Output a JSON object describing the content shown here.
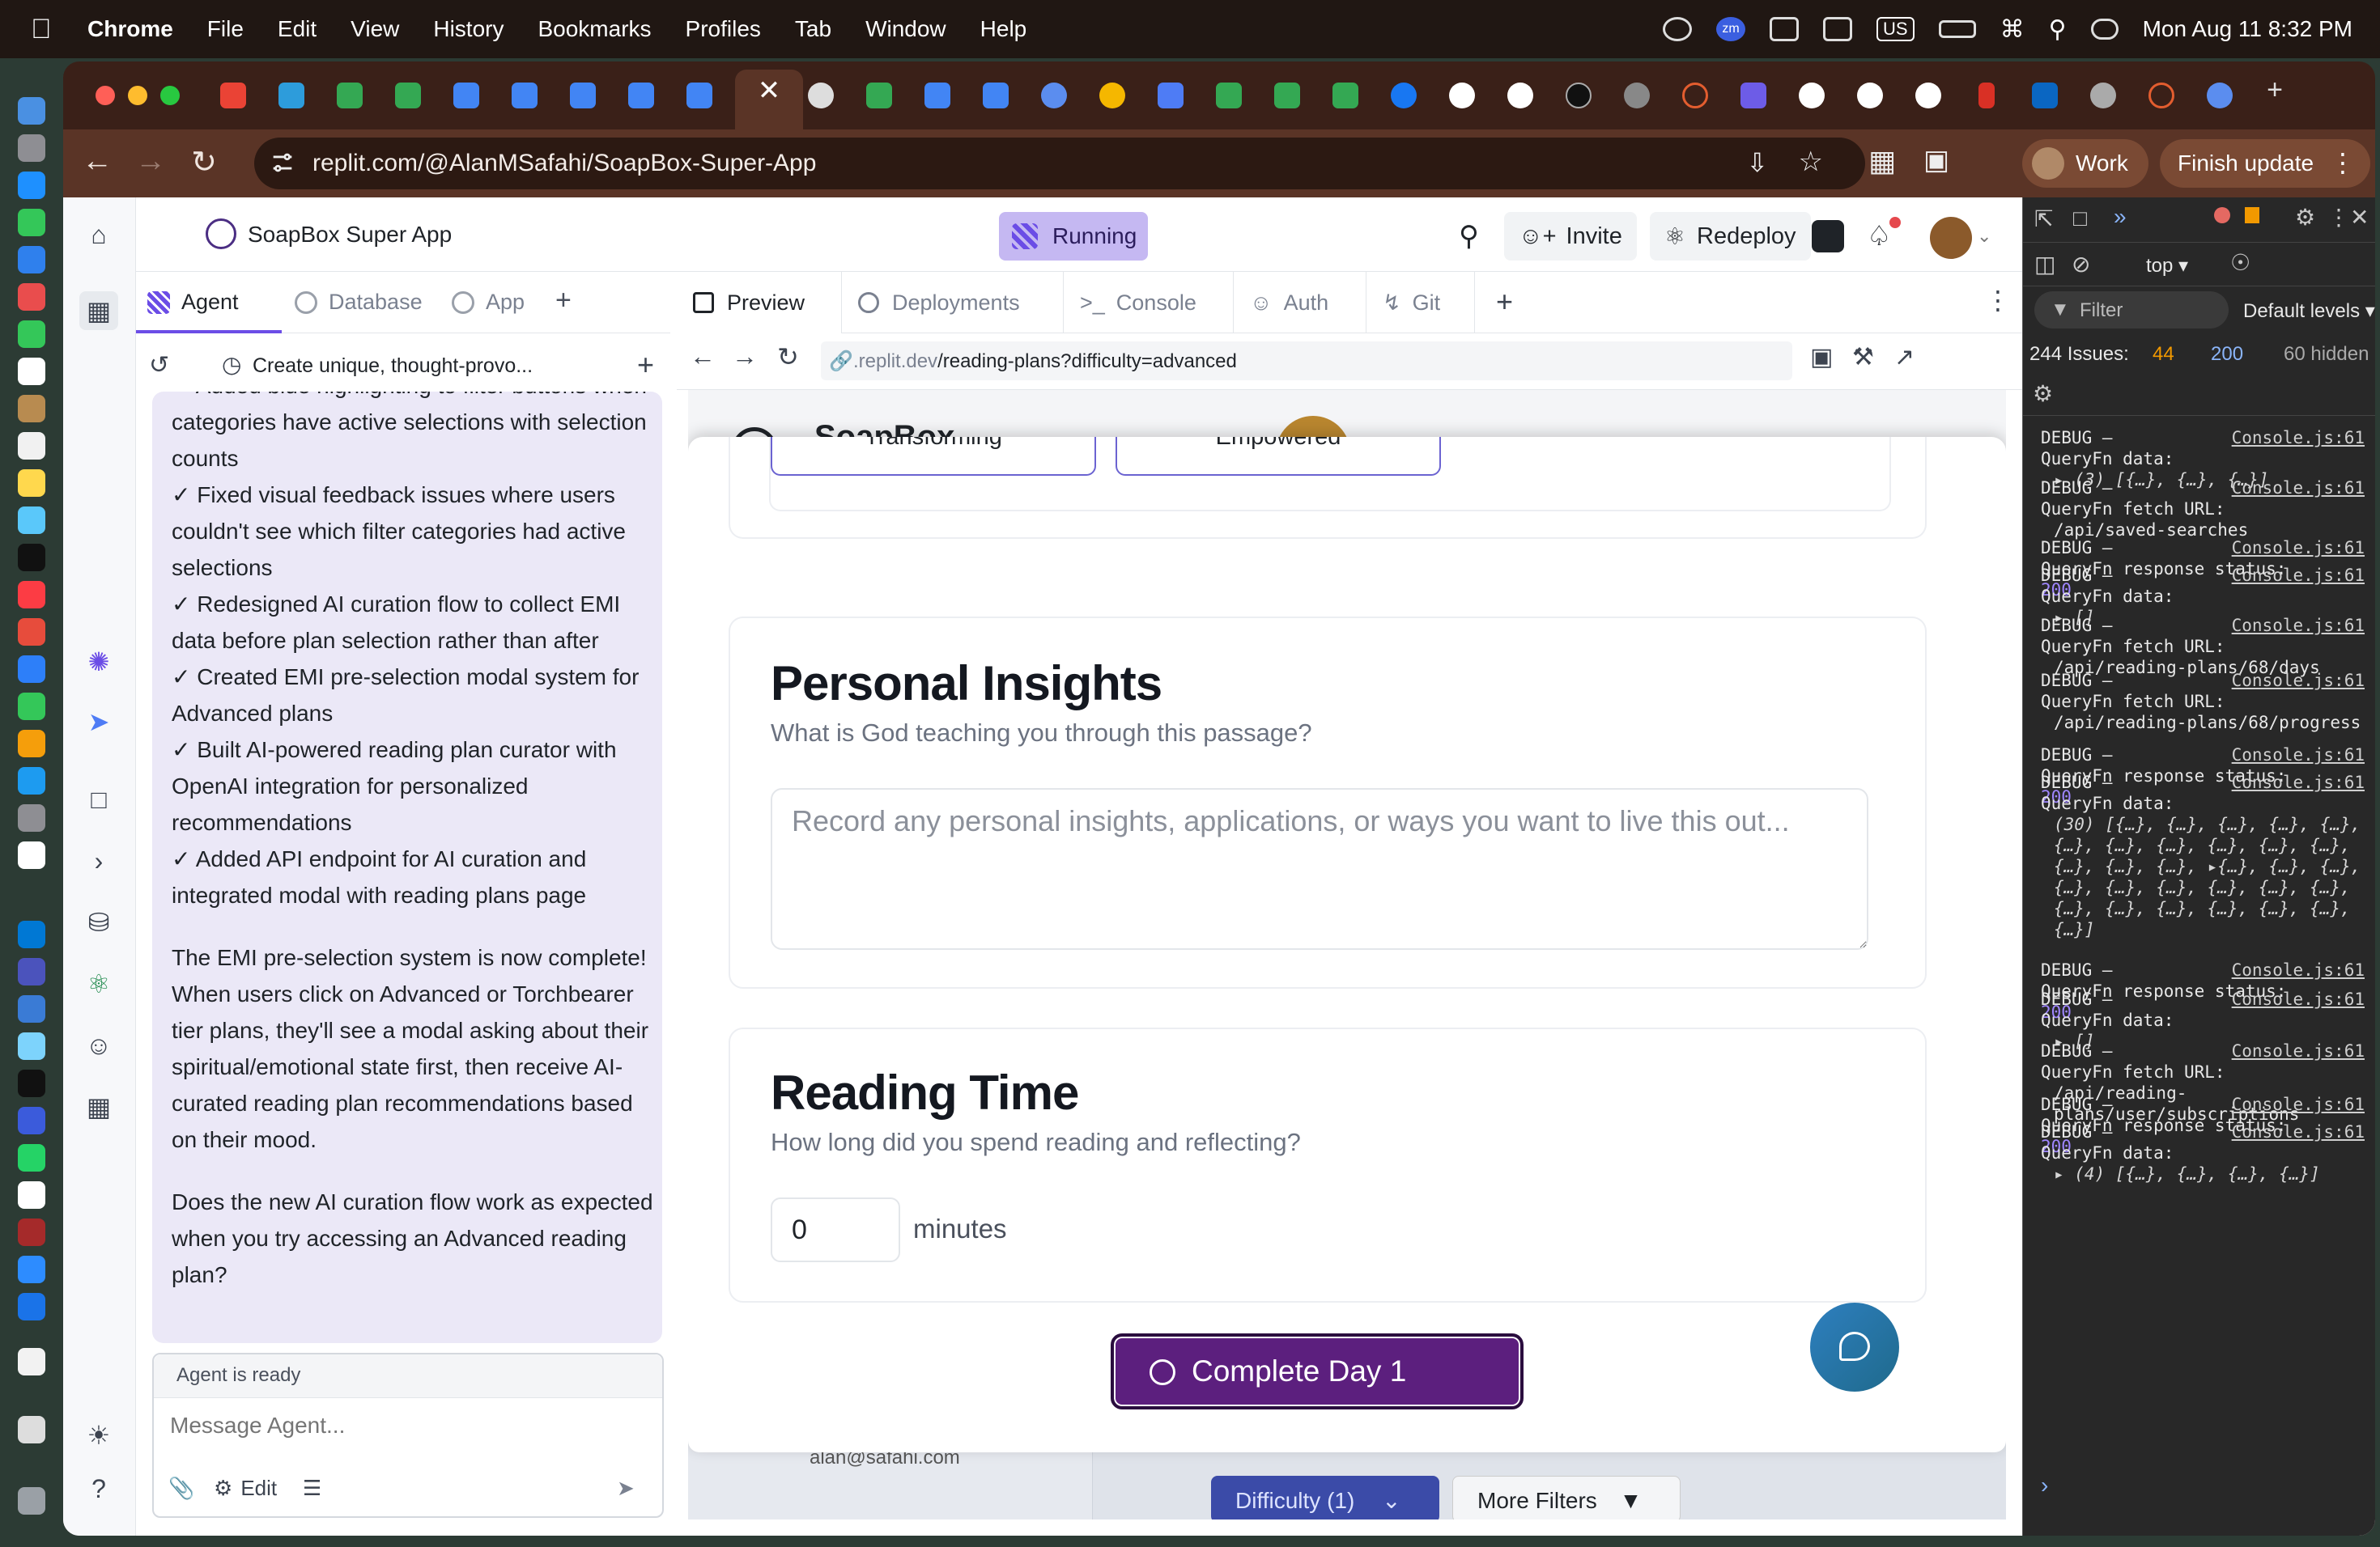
{
  "menubar": {
    "app": "Chrome",
    "items": [
      "File",
      "Edit",
      "View",
      "History",
      "Bookmarks",
      "Profiles",
      "Tab",
      "Window",
      "Help"
    ],
    "clock": "Mon Aug 11  8:32 PM",
    "input_source": "US",
    "zoom_badge": "zm"
  },
  "browser": {
    "url": "replit.com/@AlanMSafahi/SoapBox-Super-App",
    "profile": "Work",
    "update_label": "Finish update"
  },
  "replit": {
    "project_name": "SoapBox Super App",
    "run_status": "Running",
    "invite_label": "Invite",
    "redeploy_label": "Redeploy",
    "left_tabs": [
      {
        "label": "Agent"
      },
      {
        "label": "Database"
      },
      {
        "label": "App"
      }
    ],
    "thread_title": "Create unique, thought-provo...",
    "chat_lines": [
      "✓ Added blue highlighting to filter buttons when categories have active selections with selection counts",
      "✓ Fixed visual feedback issues where users couldn't see which filter categories had active selections",
      "✓ Redesigned AI curation flow to collect EMI data before plan selection rather than after",
      "✓ Created EMI pre-selection modal system for Advanced plans",
      "✓ Built AI-powered reading plan curator with OpenAI integration for personalized recommendations",
      "✓ Added API endpoint for AI curation and integrated modal with reading plans page"
    ],
    "chat_para1": "The EMI pre-selection system is now complete! When users click on Advanced or Torchbearer tier plans, they'll see a modal asking about their spiritual/emotional state first, then receive AI-curated reading plan recommendations based on their mood.",
    "chat_para2": "Does the new AI curation flow work as expected when you try accessing an Advanced reading plan?",
    "agent_status": "Agent is ready",
    "message_placeholder": "Message Agent...",
    "edit_label": "Edit",
    "preview_tabs": [
      {
        "label": "Preview"
      },
      {
        "label": "Deployments"
      },
      {
        "label": "Console"
      },
      {
        "label": "Auth"
      },
      {
        "label": "Git"
      }
    ],
    "preview_url_host": ".replit.dev",
    "preview_url_path": "/reading-plans?difficulty=advanced"
  },
  "app": {
    "brand": "SoapBox",
    "bg_letter": "C",
    "user_email": "alan@safahi.com",
    "difficulty_label": "Difficulty (1)",
    "more_filters_label": "More Filters",
    "emotions": [
      "Transforming",
      "Empowered"
    ],
    "insights_title": "Personal Insights",
    "insights_subtitle": "What is God teaching you through this passage?",
    "insights_placeholder": "Record any personal insights, applications, or ways you want to live this out...",
    "reading_title": "Reading Time",
    "reading_subtitle": "How long did you spend reading and reflecting?",
    "minutes_value": "0",
    "minutes_label": "minutes",
    "complete_label": "Complete Day 1"
  },
  "devtools": {
    "context": "top",
    "filter_placeholder": "Filter",
    "levels": "Default levels",
    "issues_label": "244 Issues:",
    "issues_warn": "44",
    "issues_info": "200",
    "hidden": "60 hidden",
    "source": "Console.js:61",
    "logs": [
      {
        "head": "DEBUG –",
        "body": "QueryFn data:",
        "detail": "▸ (3) [{…}, {…}, {…}]"
      },
      {
        "head": "DEBUG –",
        "body": "QueryFn fetch URL:",
        "detail": "/api/saved-searches"
      },
      {
        "head": "DEBUG –",
        "body": "QueryFn response status:",
        "detail": "200"
      },
      {
        "head": "DEBUG –",
        "body": "QueryFn data:",
        "detail": "▸ []"
      },
      {
        "head": "DEBUG –",
        "body": "QueryFn fetch URL:",
        "detail": "/api/reading-plans/68/days"
      },
      {
        "head": "DEBUG –",
        "body": "QueryFn fetch URL:",
        "detail": "/api/reading-plans/68/progress"
      },
      {
        "head": "DEBUG –",
        "body": "QueryFn response status:",
        "detail": "200"
      },
      {
        "head": "DEBUG –",
        "body": "QueryFn data:",
        "detail": "(30) [{…}, {…}, {…}, {…}, {…}, {…}, {…}, {…}, {…}, {…}, {…}, {…}, {…}, {…}, ▸{…}, {…}, {…}, {…}, {…}, {…}, {…}, {…}, {…}, {…}, {…}, {…}, {…}, {…}, {…}, {…}]"
      },
      {
        "head": "DEBUG –",
        "body": "QueryFn response status:",
        "detail": "200"
      },
      {
        "head": "DEBUG –",
        "body": "QueryFn data:",
        "detail": "▸ []"
      },
      {
        "head": "DEBUG –",
        "body": "QueryFn fetch URL:",
        "detail": "/api/reading-plans/user/subscriptions"
      },
      {
        "head": "DEBUG –",
        "body": "QueryFn response status:",
        "detail": "200"
      },
      {
        "head": "DEBUG –",
        "body": "QueryFn data:",
        "detail": "▸ (4) [{…}, {…}, {…}, {…}]"
      }
    ],
    "prompt": "›"
  },
  "colors": {
    "accent": "#6b4de6",
    "complete_button": "#5c1f7e",
    "chat_bg": "#ebe8f7",
    "devtools_bg": "#282828"
  }
}
